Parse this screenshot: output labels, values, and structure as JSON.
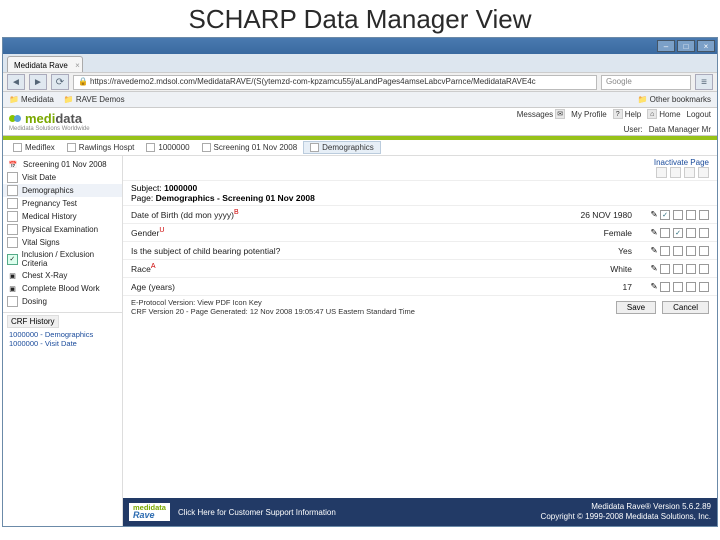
{
  "slide_title": "SCHARP Data Manager View",
  "browser": {
    "tab_title": "Medidata Rave",
    "url": "https://ravedemo2.mdsol.com/MedidataRAVE/(S(ytemzd-com-kpzamcu55j/aLandPages4amseLabcvParnce/MedidataRAVE4c",
    "search_placeholder": "Google",
    "bookmarks_left": [
      "Medidata",
      "RAVE Demos"
    ],
    "bookmarks_right": "Other bookmarks"
  },
  "app_header": {
    "brand_left": "medi",
    "brand_right": "data",
    "tagline": "Medidata Solutions Worldwide",
    "links": {
      "messages": "Messages",
      "my_profile": "My Profile",
      "help": "Help",
      "home": "Home",
      "logout": "Logout"
    },
    "user_label": "User:",
    "user_value": "Data Manager Mr"
  },
  "breadcrumbs": [
    {
      "label": "Mediflex"
    },
    {
      "label": "Rawlings Hospt"
    },
    {
      "label": "1000000"
    },
    {
      "label": "Screening 01 Nov 2008"
    },
    {
      "label": "Demographics",
      "active": true
    }
  ],
  "sidebar": {
    "items": [
      {
        "label": "Screening 01 Nov 2008",
        "type": "cal"
      },
      {
        "label": "Visit Date",
        "type": "page"
      },
      {
        "label": "Demographics",
        "type": "page",
        "selected": true
      },
      {
        "label": "Pregnancy Test",
        "type": "page"
      },
      {
        "label": "Medical History",
        "type": "page"
      },
      {
        "label": "Physical Examination",
        "type": "page"
      },
      {
        "label": "Vital Signs",
        "type": "page"
      },
      {
        "label": "Inclusion / Exclusion Criteria",
        "type": "green"
      },
      {
        "label": "Chest X-Ray",
        "type": "any"
      },
      {
        "label": "Complete Blood Work",
        "type": "any"
      },
      {
        "label": "Dosing",
        "type": "page"
      }
    ],
    "crf_history": {
      "title": "CRF History",
      "lines": [
        "1000000 - Demographics",
        "1000000 - Visit Date"
      ]
    }
  },
  "main": {
    "inactivate": "Inactivate Page",
    "subject_label": "Subject:",
    "subject_value": "1000000",
    "page_label": "Page:",
    "page_value": "Demographics - Screening 01 Nov 2008",
    "rows": [
      {
        "label": "Date of Birth (dd mon yyyy)",
        "sup": "B",
        "value": "26 NOV 1980",
        "pen": true,
        "checks": [
          "✓",
          "",
          "",
          " "
        ]
      },
      {
        "label": "Gender",
        "sup": "U",
        "value": "Female",
        "pen": true,
        "checks": [
          "",
          "✓",
          "",
          " "
        ]
      },
      {
        "label": "Is the subject of child bearing potential?",
        "sup": "",
        "value": "Yes",
        "pen": true,
        "checks": [
          "",
          "",
          "",
          " "
        ]
      },
      {
        "label": "Race",
        "sup": "A",
        "value": "White",
        "pen": true,
        "checks": [
          "",
          "",
          "",
          " "
        ]
      },
      {
        "label": "Age (years)",
        "sup": "",
        "value": "17",
        "pen": true,
        "checks": [
          "",
          "",
          "",
          " "
        ]
      }
    ],
    "iconkey_left": "E-Protocol Version: View PDF   Icon Key",
    "iconkey_right": "CRF Version 20 - Page Generated: 12 Nov 2008 19:05:47 US Eastern Standard Time",
    "save": "Save",
    "cancel": "Cancel"
  },
  "footer": {
    "support": "Click Here for Customer Support Information",
    "version": "Medidata Rave® Version 5.6.2.89",
    "copyright": "Copyright © 1999-2008 Medidata Solutions, Inc."
  }
}
